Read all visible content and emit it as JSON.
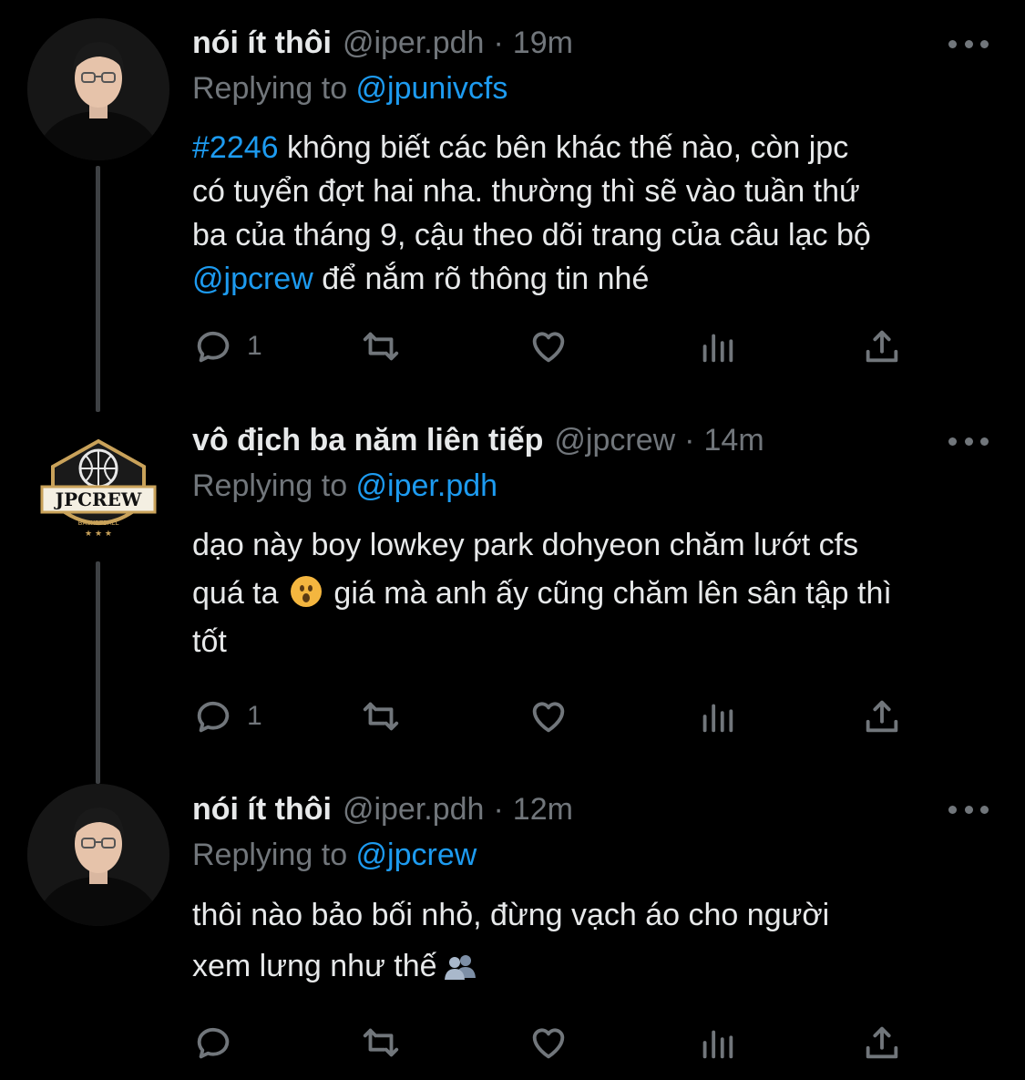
{
  "tweets": [
    {
      "name": "nói ít thôi",
      "handle": "@iper.pdh",
      "separator": "·",
      "time": "19m",
      "replying_prefix": "Replying to ",
      "replying_to": "@jpunivcfs",
      "hashtag": "#2246",
      "lines": [
        " không biết các bên khác thế nào, còn jpc",
        "có tuyển đợt hai nha. thường thì sẽ vào tuần thứ",
        "ba của tháng 9, cậu theo dõi trang của câu lạc bộ"
      ],
      "mention": "@jpcrew",
      "last_line_tail": " để nắm rõ thông tin nhé",
      "reply_count": "1"
    },
    {
      "name": "vô địch ba năm liên tiếp",
      "handle": "@jpcrew",
      "separator": "·",
      "time": "14m",
      "replying_prefix": "Replying to ",
      "replying_to": "@iper.pdh",
      "avatar_logo_text": "JPCREW",
      "avatar_logo_sub": "BASKETBALL",
      "line1": "dạo này boy lowkey park dohyeon chăm lướt cfs",
      "line2_a": "quá ta ",
      "line2_b": " giá mà anh ấy cũng chăm lên sân tập thì",
      "line3": "tốt",
      "reply_count": "1"
    },
    {
      "name": "nói ít thôi",
      "handle": "@iper.pdh",
      "separator": "·",
      "time": "12m",
      "replying_prefix": "Replying to ",
      "replying_to": "@jpcrew",
      "line1": "thôi nào bảo bối nhỏ, đừng vạch áo cho người",
      "line2": "xem lưng như thế",
      "reply_count": ""
    }
  ],
  "icons": {
    "reply": "reply-icon",
    "retweet": "retweet-icon",
    "like": "heart-icon",
    "analytics": "analytics-icon",
    "share": "share-icon",
    "more": "more-icon"
  },
  "colors": {
    "background": "#000000",
    "text": "#e7e9ea",
    "muted": "#71767b",
    "link": "#1d9bf0"
  }
}
